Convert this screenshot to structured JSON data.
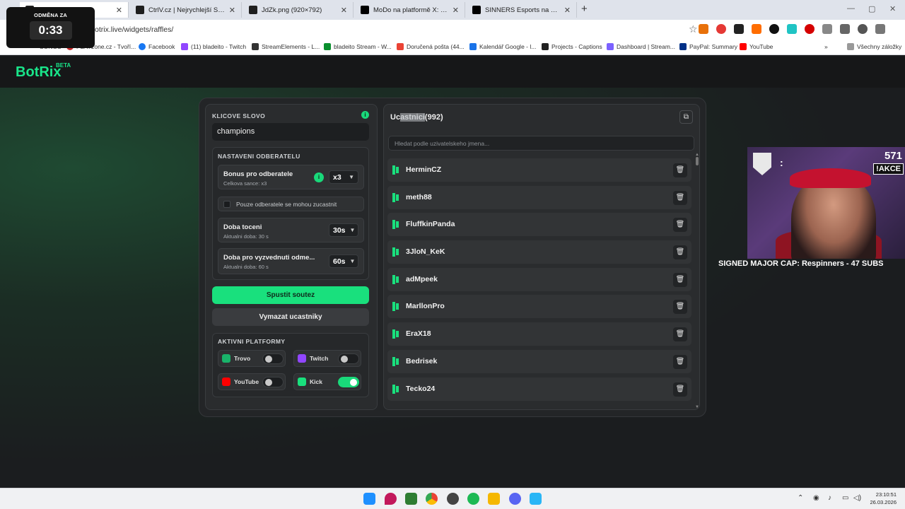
{
  "browser": {
    "tabs": [
      {
        "title": "",
        "close": "✕"
      },
      {
        "title": "CtrlV.cz | Nejrychlejší ScreenSho",
        "close": "✕"
      },
      {
        "title": "JdZk.png (920×792)",
        "close": "✕"
      },
      {
        "title": "MoDo na platformě X: „2-1 aga",
        "close": "✕"
      },
      {
        "title": "SINNERS Esports na platformě",
        "close": "✕"
      }
    ],
    "new_tab": "+",
    "url": "otrix.live/widgets/raffles/",
    "bookmarks": [
      "SONGS",
      "PLAYzone.cz - Tvoří...",
      "Facebook",
      "(11) bladeito - Twitch",
      "StreamElements - L...",
      "bladeito Stream - W...",
      "Doručená pošta (44...",
      "Kalendář Google - l...",
      "Projects - Captions",
      "Dashboard | Stream...",
      "PayPal: Summary",
      "YouTube"
    ],
    "bookmarks_more": "»",
    "all_bookmarks": "Všechny záložky"
  },
  "timer": {
    "label": "ODMĚNA ZA",
    "value": "0:33"
  },
  "app": {
    "logo": "BotRix",
    "beta": "BETA"
  },
  "left": {
    "keyword_label": "KLICOVE SLOVO",
    "keyword_value": "champions",
    "sub_settings_label": "NASTAVENI ODBERATELU",
    "bonus": {
      "title": "Bonus pro odberatele",
      "sub": "Celkova sance: x3",
      "value": "x3"
    },
    "subs_only": "Pouze odberatele se mohou zucastnit",
    "spin": {
      "title": "Doba toceni",
      "sub": "Aktualni doba: 30 s",
      "value": "30s"
    },
    "claim": {
      "title": "Doba pro vyzvednuti odme...",
      "sub": "Aktualni doba: 60 s",
      "value": "60s"
    },
    "start_button": "Spustit soutez",
    "clear_button": "Vymazat ucastniky",
    "platforms_label": "AKTIVNI PLATFORMY",
    "platforms": [
      {
        "name": "Trovo",
        "on": false,
        "color": "#19b36a"
      },
      {
        "name": "Twitch",
        "on": false,
        "color": "#9146ff"
      },
      {
        "name": "YouTube",
        "on": false,
        "color": "#ff0000"
      },
      {
        "name": "Kick",
        "on": true,
        "color": "#19e07d"
      }
    ]
  },
  "right": {
    "title_prefix": "Uc",
    "title_highlight": "astnici",
    "title_count": "(992)",
    "search_placeholder": "Hledat podle uzivatelskeho jmena...",
    "participants": [
      "HerminCZ",
      "meth88",
      "FluffkinPanda",
      "3JloN_KeK",
      "adMpeek",
      "MarllonPro",
      "EraX18",
      "Bedrisek",
      "Tecko24"
    ]
  },
  "stream_overlay": {
    "count": "571",
    "badge": "!AKCE",
    "ticker": "SIGNED MAJOR CAP: Respinners - 47 SUBS"
  },
  "taskbar": {
    "time": "23:10:51",
    "date": "26.03.2026"
  },
  "colors": {
    "accent": "#19e07d",
    "panel": "#232527",
    "background": "#1b1d1f"
  }
}
